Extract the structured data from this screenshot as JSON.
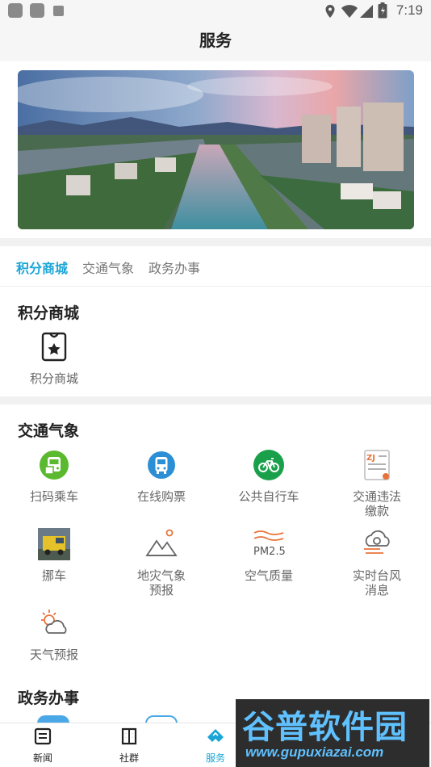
{
  "status_bar": {
    "time": "7:19"
  },
  "header": {
    "title": "服务"
  },
  "tabs": [
    {
      "label": "积分商城",
      "active": true
    },
    {
      "label": "交通气象",
      "active": false
    },
    {
      "label": "政务办事",
      "active": false
    }
  ],
  "sections": {
    "points_mall": {
      "title": "积分商城",
      "items": [
        {
          "label": "积分商城",
          "icon": "tag-icon"
        }
      ]
    },
    "traffic_weather": {
      "title": "交通气象",
      "items": [
        {
          "label": "扫码乘车",
          "icon": "bus-scan-icon"
        },
        {
          "label": "在线购票",
          "icon": "bus-ticket-icon"
        },
        {
          "label": "公共自行车",
          "icon": "bicycle-icon"
        },
        {
          "label": "交通违法缴款",
          "line1": "交通违法",
          "line2": "缴款",
          "icon": "traffic-fine-icon"
        },
        {
          "label": "挪车",
          "icon": "tow-truck-icon"
        },
        {
          "label": "地灾气象预报",
          "line1": "地灾气象",
          "line2": "预报",
          "icon": "mountain-icon"
        },
        {
          "label": "空气质量",
          "icon": "pm25-icon"
        },
        {
          "label": "实时台风消息",
          "line1": "实时台风",
          "line2": "消息",
          "icon": "typhoon-icon"
        },
        {
          "label": "天气预报",
          "icon": "weather-icon"
        }
      ]
    },
    "government": {
      "title": "政务办事"
    }
  },
  "bottom_nav": [
    {
      "label": "新闻",
      "icon": "news-icon",
      "active": false
    },
    {
      "label": "社群",
      "icon": "community-icon",
      "active": false
    },
    {
      "label": "服务",
      "icon": "service-icon",
      "active": true
    }
  ],
  "watermark": {
    "main": "谷普软件园",
    "sub": "www.gupuxiazai.com"
  },
  "colors": {
    "accent": "#1aa5d6",
    "green": "#1aa04a",
    "orange": "#e8733a"
  }
}
